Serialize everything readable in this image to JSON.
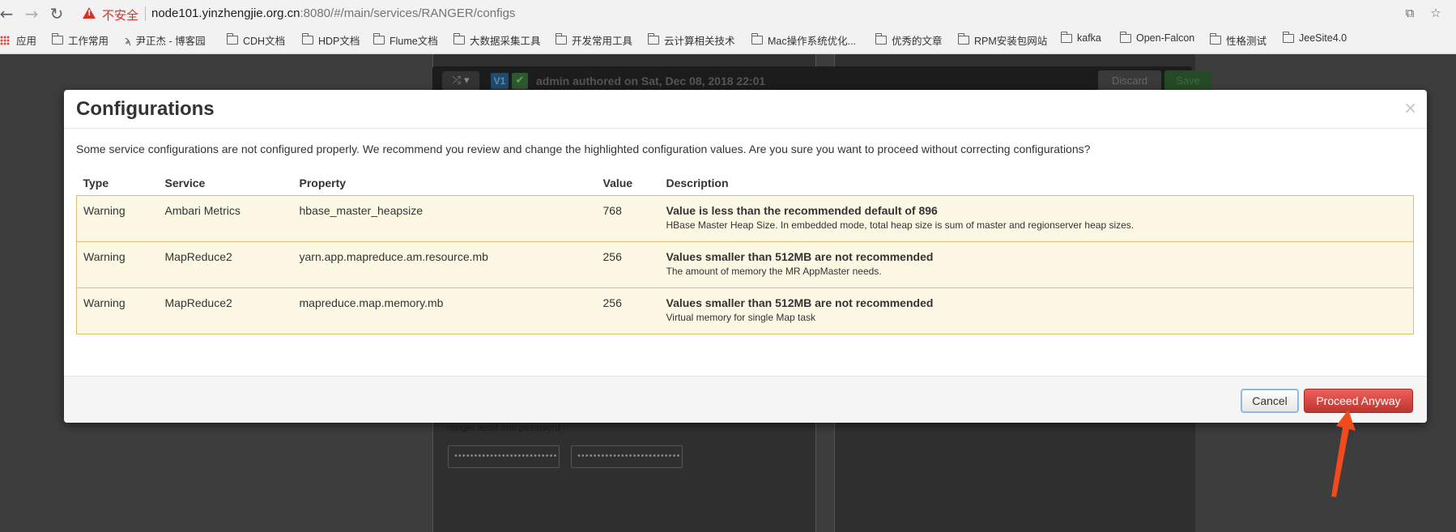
{
  "browser": {
    "insecure_label": "不安全",
    "url_host": "node101.yinzhengjie.org.cn",
    "url_rest": ":8080/#/main/services/RANGER/configs",
    "nav_icons": [
      "back-icon",
      "forward-icon",
      "reload-icon"
    ],
    "bookmarks": [
      {
        "label": "应用",
        "icon": "apps-icon"
      },
      {
        "label": "工作常用",
        "icon": "folder-icon"
      },
      {
        "label": "尹正杰 - 博客园",
        "icon": "page-icon"
      },
      {
        "label": "CDH文档",
        "icon": "folder-icon"
      },
      {
        "label": "HDP文档",
        "icon": "folder-icon"
      },
      {
        "label": "Flume文档",
        "icon": "folder-icon"
      },
      {
        "label": "大数据采集工具",
        "icon": "folder-icon"
      },
      {
        "label": "开发常用工具",
        "icon": "folder-icon"
      },
      {
        "label": "云计算相关技术",
        "icon": "folder-icon"
      },
      {
        "label": "Mac操作系统优化...",
        "icon": "folder-icon"
      },
      {
        "label": "优秀的文章",
        "icon": "folder-icon"
      },
      {
        "label": "RPM安装包网站",
        "icon": "folder-icon"
      },
      {
        "label": "kafka",
        "icon": "folder-icon"
      },
      {
        "label": "Open-Falcon",
        "icon": "folder-icon"
      },
      {
        "label": "性格测试",
        "icon": "folder-icon"
      },
      {
        "label": "JeeSite4.0",
        "icon": "folder-icon"
      }
    ]
  },
  "background_page": {
    "version_badge": "V1",
    "author_text": "admin authored on Sat, Dec 08, 2018 22:01",
    "discard_label": "Discard",
    "save_label": "Save",
    "field_label": "ranger.audit.solr.password",
    "password_mask": "••••••••••••••••••••••••••"
  },
  "modal": {
    "title": "Configurations",
    "close_glyph": "×",
    "intro": "Some service configurations are not configured properly. We recommend you review and change the highlighted configuration values. Are you sure you want to proceed without correcting configurations?",
    "columns": [
      "Type",
      "Service",
      "Property",
      "Value",
      "Description"
    ],
    "rows": [
      {
        "type": "Warning",
        "service": "Ambari Metrics",
        "property": "hbase_master_heapsize",
        "value": "768",
        "desc_title": "Value is less than the recommended default of 896",
        "desc_text": "HBase Master Heap Size. In embedded mode, total heap size is sum of master and regionserver heap sizes."
      },
      {
        "type": "Warning",
        "service": "MapReduce2",
        "property": "yarn.app.mapreduce.am.resource.mb",
        "value": "256",
        "desc_title": "Values smaller than 512MB are not recommended",
        "desc_text": "The amount of memory the MR AppMaster needs."
      },
      {
        "type": "Warning",
        "service": "MapReduce2",
        "property": "mapreduce.map.memory.mb",
        "value": "256",
        "desc_title": "Values smaller than 512MB are not recommended",
        "desc_text": "Virtual memory for single Map task"
      }
    ],
    "cancel_label": "Cancel",
    "proceed_label": "Proceed Anyway"
  },
  "colors": {
    "warning_row_bg": "#fcf8e3",
    "warning_border": "#d9bd79",
    "danger_button": "#da4f49",
    "annotation_arrow": "#f04a1d"
  }
}
